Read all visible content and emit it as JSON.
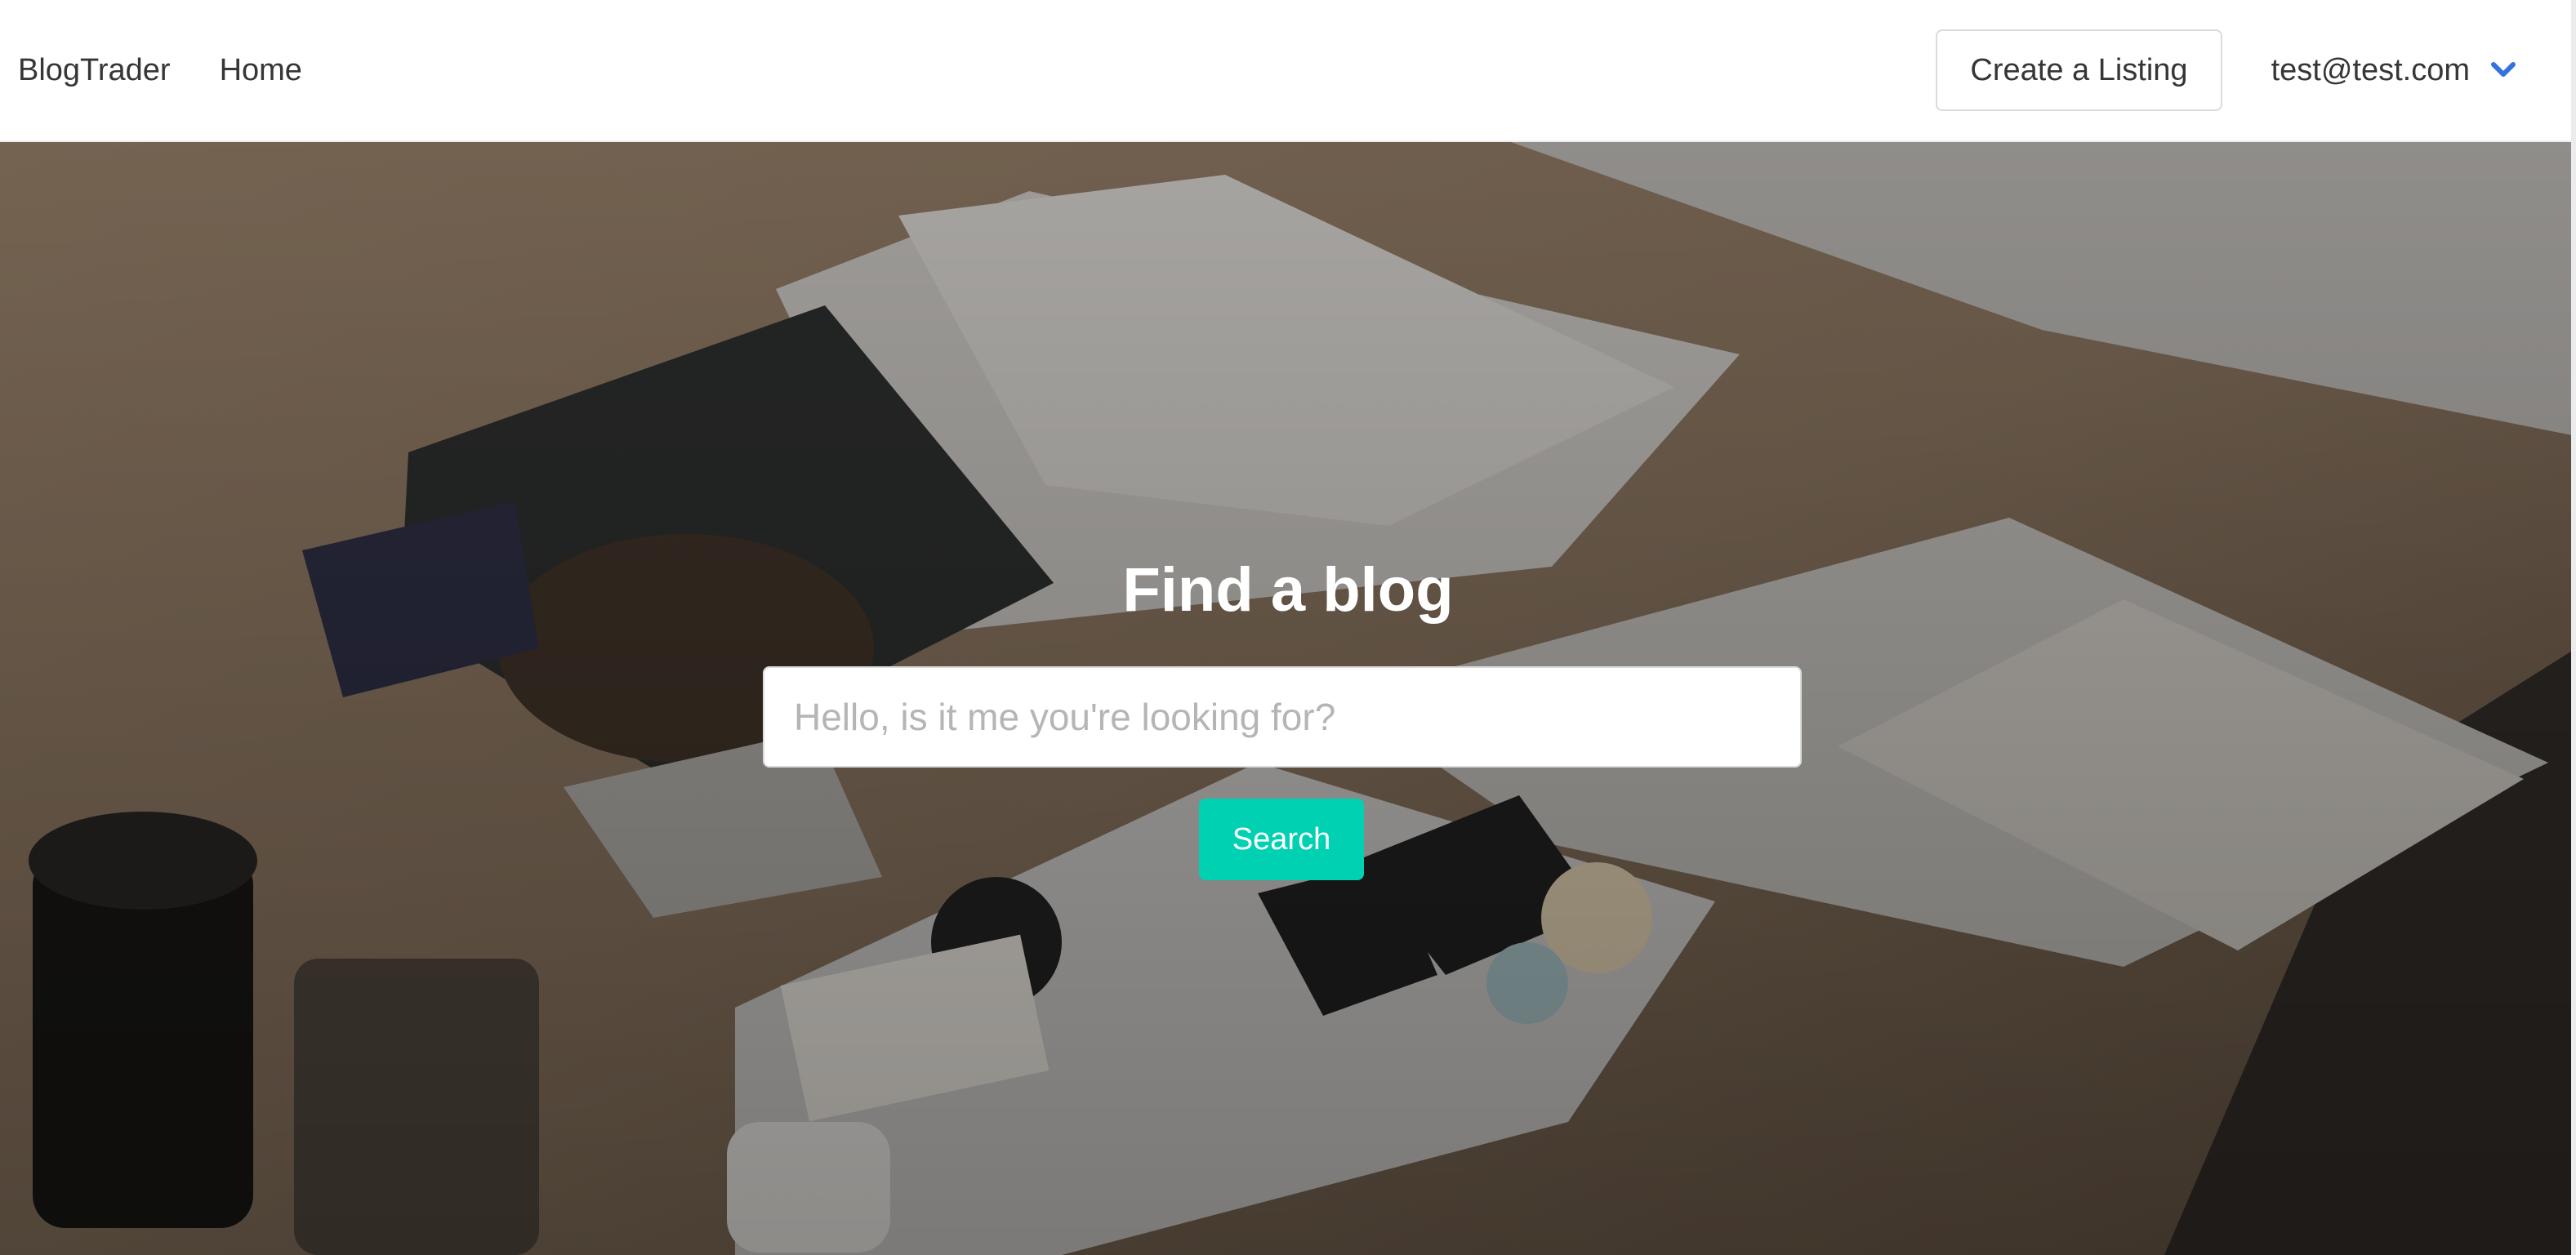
{
  "navbar": {
    "brand": "BlogTrader",
    "home": "Home",
    "create_listing": "Create a Listing",
    "user_email": "test@test.com",
    "user_menu_icon": "chevron-down-icon"
  },
  "hero": {
    "title": "Find a blog",
    "search_placeholder": "Hello, is it me you're looking for?",
    "search_value": "",
    "search_button": "Search",
    "background": "desk-workspace-photo"
  },
  "colors": {
    "accent": "#00d1b2",
    "chevron": "#3273dc",
    "text": "#363636"
  }
}
